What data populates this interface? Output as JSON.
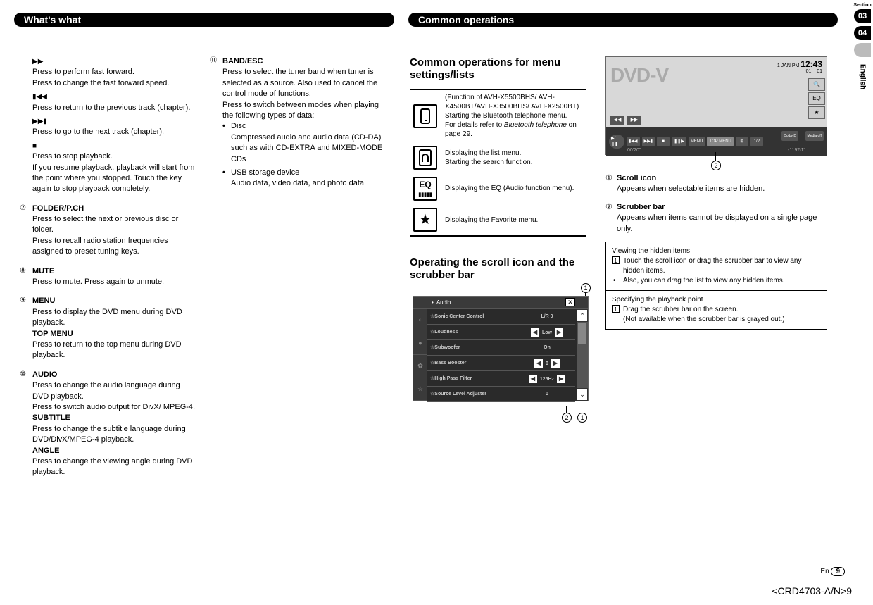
{
  "section_label": "Section",
  "tabs": {
    "t03": "03",
    "t04": "04",
    "lang": "English"
  },
  "header_left": "What's what",
  "header_right": "Common operations",
  "col1": {
    "ff": {
      "l1": "Press to perform fast forward.",
      "l2": "Press to change the fast forward speed."
    },
    "prev": "Press to return to the previous track (chapter).",
    "next": "Press to go to the next track (chapter).",
    "stop": {
      "l1": "Press to stop playback.",
      "l2": "If you resume playback, playback will start from the point where you stopped. Touch the key again to stop playback completely."
    },
    "n7": {
      "num": "⑦",
      "title": "FOLDER/P.CH",
      "l1": "Press to select the next or previous disc or folder.",
      "l2": "Press to recall radio station frequencies assigned to preset tuning keys."
    },
    "n8": {
      "num": "⑧",
      "title": "MUTE",
      "l1": "Press to mute. Press again to unmute."
    },
    "n9": {
      "num": "⑨",
      "title": "MENU",
      "l1": "Press to display the DVD menu during DVD playback.",
      "sub1": "TOP MENU",
      "l2": "Press to return to the top menu during DVD playback."
    },
    "n10": {
      "num": "⑩",
      "title": "AUDIO",
      "l1": "Press to change the audio language during DVD playback.",
      "l2": "Press to switch audio output for DivX/ MPEG-4.",
      "sub1": "SUBTITLE",
      "l3": "Press to change the subtitle language during DVD/DivX/MPEG-4 playback.",
      "sub2": "ANGLE",
      "l4": "Press to change the viewing angle during DVD playback."
    }
  },
  "col2": {
    "n11": {
      "num": "⑪",
      "title": "BAND/ESC",
      "l1": "Press to select the tuner band when tuner is selected as a source. Also used to cancel the control mode of functions.",
      "l2": "Press to switch between modes when playing the following types of data:",
      "b1": "Disc",
      "b1d": "Compressed audio and audio data (CD-DA) such as with CD-EXTRA and MIXED-MODE CDs",
      "b2": "USB storage device",
      "b2d": "Audio data, video data, and photo data"
    }
  },
  "col3": {
    "h1": "Common operations for menu settings/lists",
    "rows": {
      "r1": "(Function of AVH-X5500BHS/ AVH-X4500BT/AVH-X3500BHS/ AVH-X2500BT)\nStarting the Bluetooth telephone menu.\nFor details refer to Bluetooth telephone on page 29.",
      "r2": "Displaying the list menu.\nStarting the search function.",
      "r3": "Displaying the EQ (Audio function menu).",
      "r4": "Displaying the Favorite menu."
    },
    "h2": "Operating the scroll icon and the scrubber bar",
    "audio": {
      "title": "Audio",
      "rows": [
        {
          "label": "Sonic Center Control",
          "val": "L/R  0"
        },
        {
          "label": "Loudness",
          "val": "Low",
          "arrows": true
        },
        {
          "label": "Subwoofer",
          "val": "On"
        },
        {
          "label": "Bass Booster",
          "val": "0",
          "arrows": true
        },
        {
          "label": "High Pass Filter",
          "val": "125Hz",
          "arrows": true
        },
        {
          "label": "Source Level Adjuster",
          "val": "0"
        }
      ]
    }
  },
  "col4": {
    "dvd": {
      "title": "DVD-V",
      "date": "1 JAN",
      "ampm": "PM",
      "time": "12:43",
      "t1": "01",
      "t2": "01",
      "left_time": "00'20\"",
      "right_time": "-119'51\"",
      "topmenu": "TOP MENU",
      "menu": "MENU",
      "media": "Media off",
      "dolby": "Dolby D",
      "chap": "1/2"
    },
    "n1": {
      "num": "①",
      "title": "Scroll icon",
      "desc": "Appears when selectable items are hidden."
    },
    "n2": {
      "num": "②",
      "title": "Scrubber bar",
      "desc": "Appears when items cannot be displayed on a single page only."
    },
    "box1": {
      "title": "Viewing the hidden items",
      "i1": "Touch the scroll icon or drag the scrubber bar to view any hidden items.",
      "i2": "Also, you can drag the list to view any hidden items."
    },
    "box2": {
      "title": "Specifying the playback point",
      "i1": "Drag the scrubber bar on the screen.",
      "i1b": "(Not available when the scrubber bar is grayed out.)"
    }
  },
  "page": {
    "en": "En",
    "num": "9"
  },
  "doc_id": "<CRD4703-A/N>9"
}
